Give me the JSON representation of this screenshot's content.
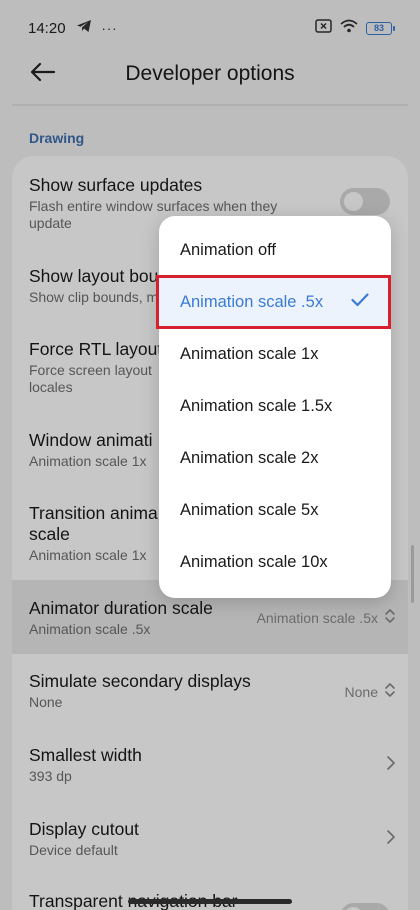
{
  "status_bar": {
    "time": "14:20",
    "ellipsis": "···",
    "battery": "83",
    "icons": [
      "telegram-icon",
      "close-box-icon",
      "wifi-icon",
      "battery-icon"
    ]
  },
  "header": {
    "title": "Developer options",
    "back_icon": "arrow-left-icon"
  },
  "section": {
    "label": "Drawing"
  },
  "settings": [
    {
      "title": "Show surface updates",
      "subtitle": "Flash entire window surfaces when they update",
      "control": "toggle"
    },
    {
      "title": "Show layout bou",
      "subtitle": "Show clip bounds, m"
    },
    {
      "title": "Force RTL layout",
      "subtitle": "Force screen layout locales"
    },
    {
      "title": "Window animati",
      "subtitle": "Animation scale 1x"
    },
    {
      "title": "Transition anima scale",
      "subtitle": "Animation scale 1x"
    },
    {
      "title": "Animator duration scale",
      "subtitle": "Animation scale .5x",
      "value": "Animation scale .5x"
    },
    {
      "title": "Simulate secondary displays",
      "subtitle": "None",
      "value": "None"
    },
    {
      "title": "Smallest width",
      "subtitle": "393 dp"
    },
    {
      "title": "Display cutout",
      "subtitle": "Device default"
    },
    {
      "title": "Transparent navigation bar"
    }
  ],
  "popup": {
    "options": [
      "Animation off",
      "Animation scale .5x",
      "Animation scale 1x",
      "Animation scale 1.5x",
      "Animation scale 2x",
      "Animation scale 5x",
      "Animation scale 10x"
    ],
    "selected_index": 1
  },
  "colors": {
    "accent": "#3a7bd5",
    "section_label": "#3f6fb0",
    "highlight_outline": "#d7202e"
  }
}
